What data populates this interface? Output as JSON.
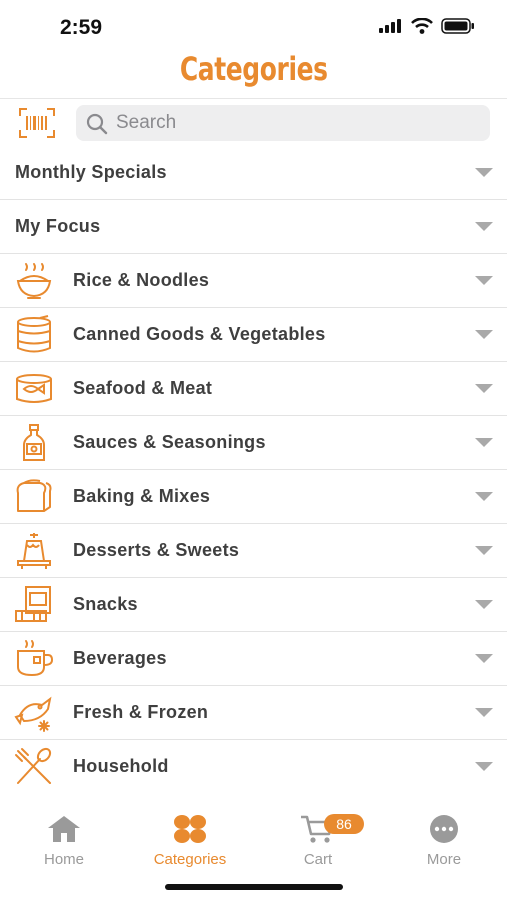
{
  "status": {
    "time": "2:59"
  },
  "header": {
    "title": "Categories"
  },
  "search": {
    "placeholder": "Search"
  },
  "colors": {
    "accent": "#e88a2f",
    "text": "#3f3f3f",
    "chevron": "#a9a9a9",
    "tab_inactive": "#9a9a9a"
  },
  "categories": [
    {
      "label": "Monthly Specials",
      "icon": null
    },
    {
      "label": "My Focus",
      "icon": null
    },
    {
      "label": "Rice & Noodles",
      "icon": "rice-bowl-icon"
    },
    {
      "label": "Canned Goods & Vegetables",
      "icon": "can-icon"
    },
    {
      "label": "Seafood & Meat",
      "icon": "fish-can-icon"
    },
    {
      "label": "Sauces & Seasonings",
      "icon": "sauce-bottle-icon"
    },
    {
      "label": "Baking & Mixes",
      "icon": "bread-icon"
    },
    {
      "label": "Desserts & Sweets",
      "icon": "cake-icon"
    },
    {
      "label": "Snacks",
      "icon": "snack-icon"
    },
    {
      "label": "Beverages",
      "icon": "cup-icon"
    },
    {
      "label": "Fresh & Frozen",
      "icon": "fish-snowflake-icon"
    },
    {
      "label": "Household",
      "icon": "utensils-icon"
    }
  ],
  "tabbar": {
    "home": "Home",
    "categories": "Categories",
    "cart": "Cart",
    "cart_count": "86",
    "more": "More"
  }
}
